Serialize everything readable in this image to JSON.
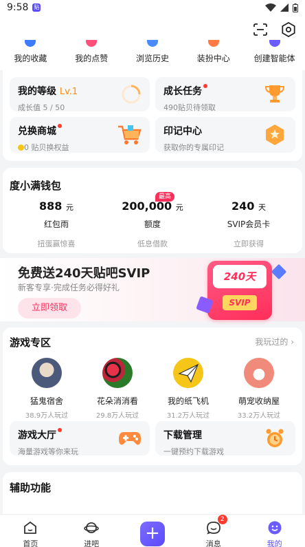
{
  "status_bar": {
    "time": "9:58"
  },
  "quick_actions": [
    {
      "label": "我的收藏",
      "color": "#3d7bff"
    },
    {
      "label": "我的点赞",
      "color": "#ff4f7b"
    },
    {
      "label": "浏览历史",
      "color": "#4a8cff"
    },
    {
      "label": "装扮中心",
      "color": "#ff7a45"
    },
    {
      "label": "创建智能体",
      "color": "#6c5cff"
    }
  ],
  "tiles": {
    "level": {
      "title": "我的等级",
      "level": "Lv.1",
      "sub": "成长值 5 / 50"
    },
    "tasks": {
      "title": "成长任务",
      "sub": "490贴贝待领取"
    },
    "mall": {
      "title": "兑换商城",
      "sub": "0 贴贝换权益"
    },
    "imprint": {
      "title": "印记中心",
      "sub": "获取你的专属印记"
    }
  },
  "wallet": {
    "title": "度小满钱包",
    "badge": "最高",
    "items": [
      {
        "value": "888",
        "unit": "元",
        "name": "红包雨",
        "desc": "扭蛋赢惊喜"
      },
      {
        "value": "200,000",
        "unit": "元",
        "name": "额度",
        "desc": "低息借款"
      },
      {
        "value": "240",
        "unit": "天",
        "name": "SVIP会员卡",
        "desc": "立即获得"
      }
    ]
  },
  "banner": {
    "headline": "免费送240天贴吧SVIP",
    "sub": "新客专享·完成任务必得好礼",
    "cta": "立即领取",
    "card_text": "240天SVIP",
    "card_logo": "SVIP"
  },
  "games": {
    "title": "游戏专区",
    "link": "我玩过的",
    "items": [
      {
        "name": "猛鬼宿舍",
        "count": "38.9万人玩过",
        "color": "#4b5a7a"
      },
      {
        "name": "花朵消消看",
        "count": "29.8万人玩过",
        "color": "#c0263a"
      },
      {
        "name": "我的纸飞机",
        "count": "31.2万人玩过",
        "color": "#f5c518"
      },
      {
        "name": "萌宠收纳屋",
        "count": "33.2万人玩过",
        "color": "#f08a7a"
      }
    ],
    "hall": {
      "title": "游戏大厅",
      "sub": "海量游戏等你来玩"
    },
    "download": {
      "title": "下载管理",
      "sub": "一键预约下载游戏"
    }
  },
  "aux": {
    "title": "辅助功能"
  },
  "tabbar": {
    "items": [
      {
        "label": "首页"
      },
      {
        "label": "进吧"
      },
      {
        "label": ""
      },
      {
        "label": "消息",
        "badge": "2"
      },
      {
        "label": "我的"
      }
    ],
    "active_color": "#5b4bff"
  }
}
